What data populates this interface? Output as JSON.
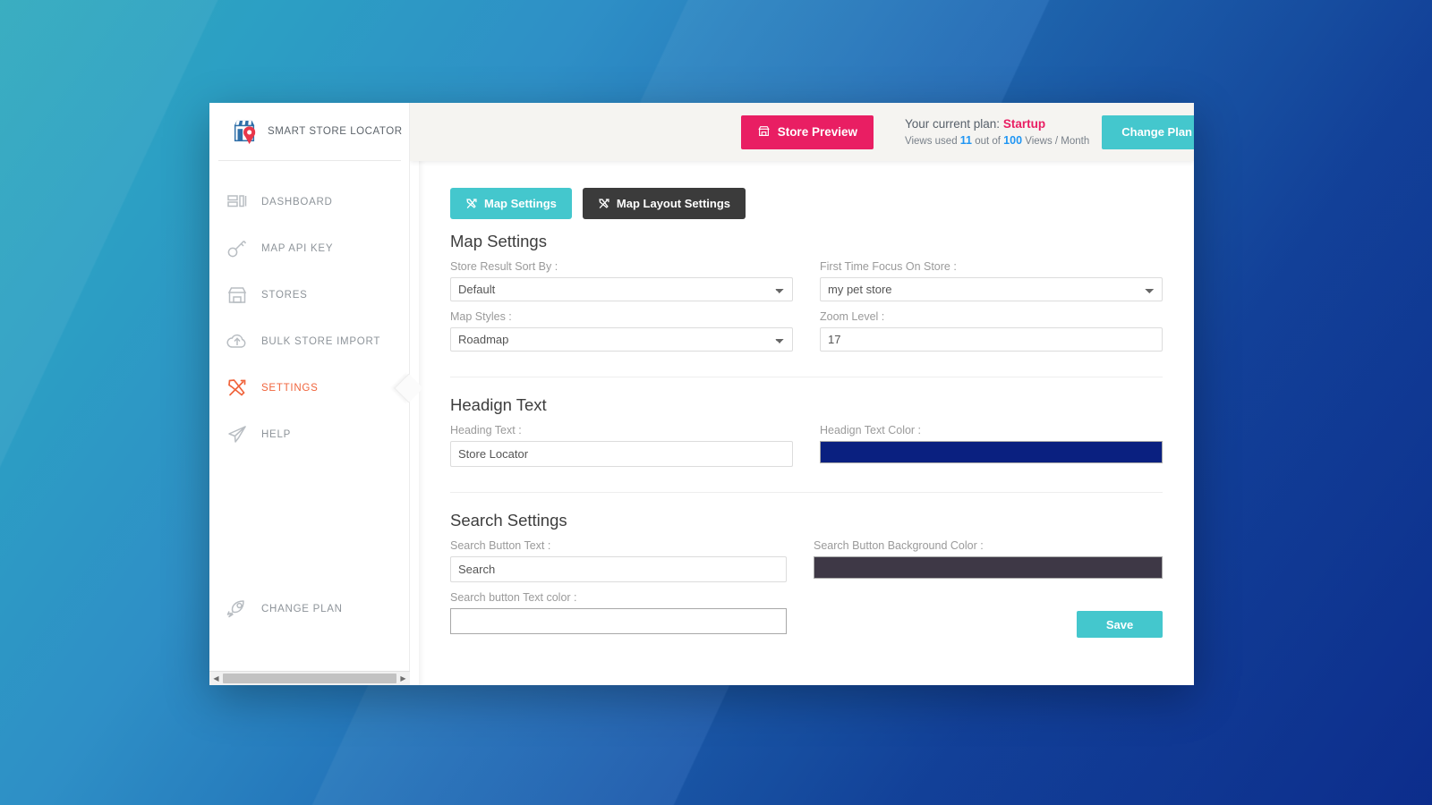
{
  "brand": {
    "name": "SMART STORE LOCATOR",
    "logo_icon": "store-pin-logo-icon"
  },
  "sidebar": {
    "items": [
      {
        "label": "DASHBOARD",
        "icon": "dashboard-icon",
        "active": false
      },
      {
        "label": "MAP API KEY",
        "icon": "key-icon",
        "active": false
      },
      {
        "label": "STORES",
        "icon": "store-icon",
        "active": false
      },
      {
        "label": "BULK STORE IMPORT",
        "icon": "cloud-upload-icon",
        "active": false
      },
      {
        "label": "SETTINGS",
        "icon": "tools-icon",
        "active": true
      },
      {
        "label": "HELP",
        "icon": "paper-plane-icon",
        "active": false
      }
    ],
    "bottom_item": {
      "label": "CHANGE PLAN",
      "icon": "rocket-icon"
    },
    "scrollbar": {
      "left_arrow": "◀",
      "right_arrow": "▶"
    }
  },
  "topbar": {
    "store_preview_label": "Store Preview",
    "store_preview_icon": "store-front-icon",
    "plan_prefix": "Your current plan: ",
    "plan_name": "Startup",
    "views_prefix": "Views used ",
    "views_used": "11",
    "views_middle": " out of ",
    "views_total": "100",
    "views_suffix": " Views / Month",
    "change_plan_label": "Change Plan"
  },
  "tabs": [
    {
      "label": "Map Settings",
      "icon": "tools-icon",
      "active": true
    },
    {
      "label": "Map Layout Settings",
      "icon": "tools-icon",
      "active": false
    }
  ],
  "map_settings": {
    "title": "Map Settings",
    "sort_by": {
      "label": "Store Result Sort By :",
      "value": "Default",
      "options": [
        "Default"
      ]
    },
    "focus_store": {
      "label": "First Time Focus On Store :",
      "value": "my pet store",
      "options": [
        "my pet store"
      ]
    },
    "map_styles": {
      "label": "Map Styles :",
      "value": "Roadmap",
      "options": [
        "Roadmap"
      ]
    },
    "zoom_level": {
      "label": "Zoom Level :",
      "value": "17"
    }
  },
  "heading_text": {
    "title": "Headign Text",
    "heading": {
      "label": "Heading Text :",
      "value": "Store Locator"
    },
    "color": {
      "label": "Headign Text Color :",
      "value": "#0a2080"
    }
  },
  "search_settings": {
    "title": "Search Settings",
    "button_text": {
      "label": "Search Button Text :",
      "value": "Search"
    },
    "bg_color": {
      "label": "Search Button Background Color :",
      "value": "#3e3846"
    },
    "text_color": {
      "label": "Search button Text color :",
      "value": ""
    },
    "save_label": "Save"
  },
  "colors": {
    "accent_teal": "#44c7cd",
    "accent_pink": "#e91e63",
    "active_orange": "#f0643c",
    "dark_tab": "#3b3b3b",
    "link_blue": "#2196f3"
  }
}
